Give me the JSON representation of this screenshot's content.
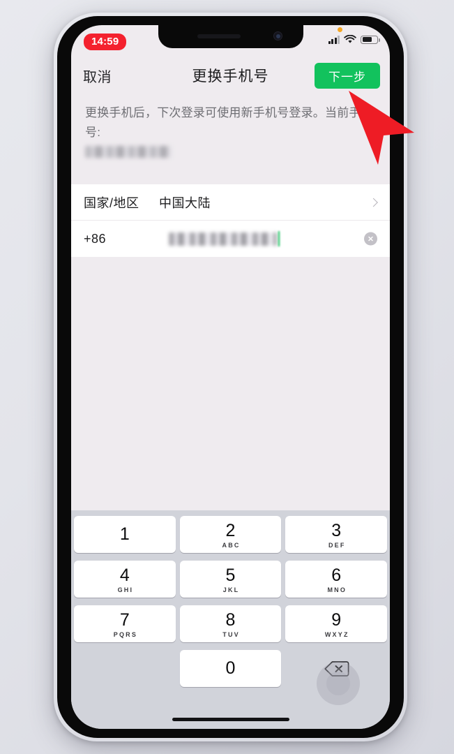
{
  "status_bar": {
    "time": "14:59",
    "recording_indicator_color": "#f4212e",
    "mic_in_use_dot": "orange-dot-icon",
    "signal_icon": "cellular-signal-icon",
    "wifi_icon": "wifi-icon",
    "battery_icon": "battery-icon"
  },
  "nav": {
    "cancel_label": "取消",
    "title": "更换手机号",
    "next_label": "下一步",
    "next_button_color": "#12c25d"
  },
  "description": {
    "text": "更换手机后，下次登录可使用新手机号登录。当前手机号:",
    "current_phone_masked": ""
  },
  "form": {
    "country_label": "国家/地区",
    "country_value": "中国大陆",
    "chevron_icon": "chevron-right-icon",
    "dial_code": "+86",
    "phone_value": "",
    "clear_icon": "clear-circle-icon",
    "cursor_color": "#12c25d"
  },
  "keypad": {
    "keys": [
      {
        "digit": "1",
        "letters": ""
      },
      {
        "digit": "2",
        "letters": "ABC"
      },
      {
        "digit": "3",
        "letters": "DEF"
      },
      {
        "digit": "4",
        "letters": "GHI"
      },
      {
        "digit": "5",
        "letters": "JKL"
      },
      {
        "digit": "6",
        "letters": "MNO"
      },
      {
        "digit": "7",
        "letters": "PQRS"
      },
      {
        "digit": "8",
        "letters": "TUV"
      },
      {
        "digit": "9",
        "letters": "WXYZ"
      },
      {
        "digit": "0",
        "letters": ""
      }
    ],
    "backspace_icon": "backspace-icon"
  },
  "overlays": {
    "assistive_touch_icon": "assistive-touch-icon",
    "home_indicator": "home-indicator",
    "pointer_icon": "red-arrow-cursor-icon",
    "pointer_color": "#ee1c25"
  }
}
